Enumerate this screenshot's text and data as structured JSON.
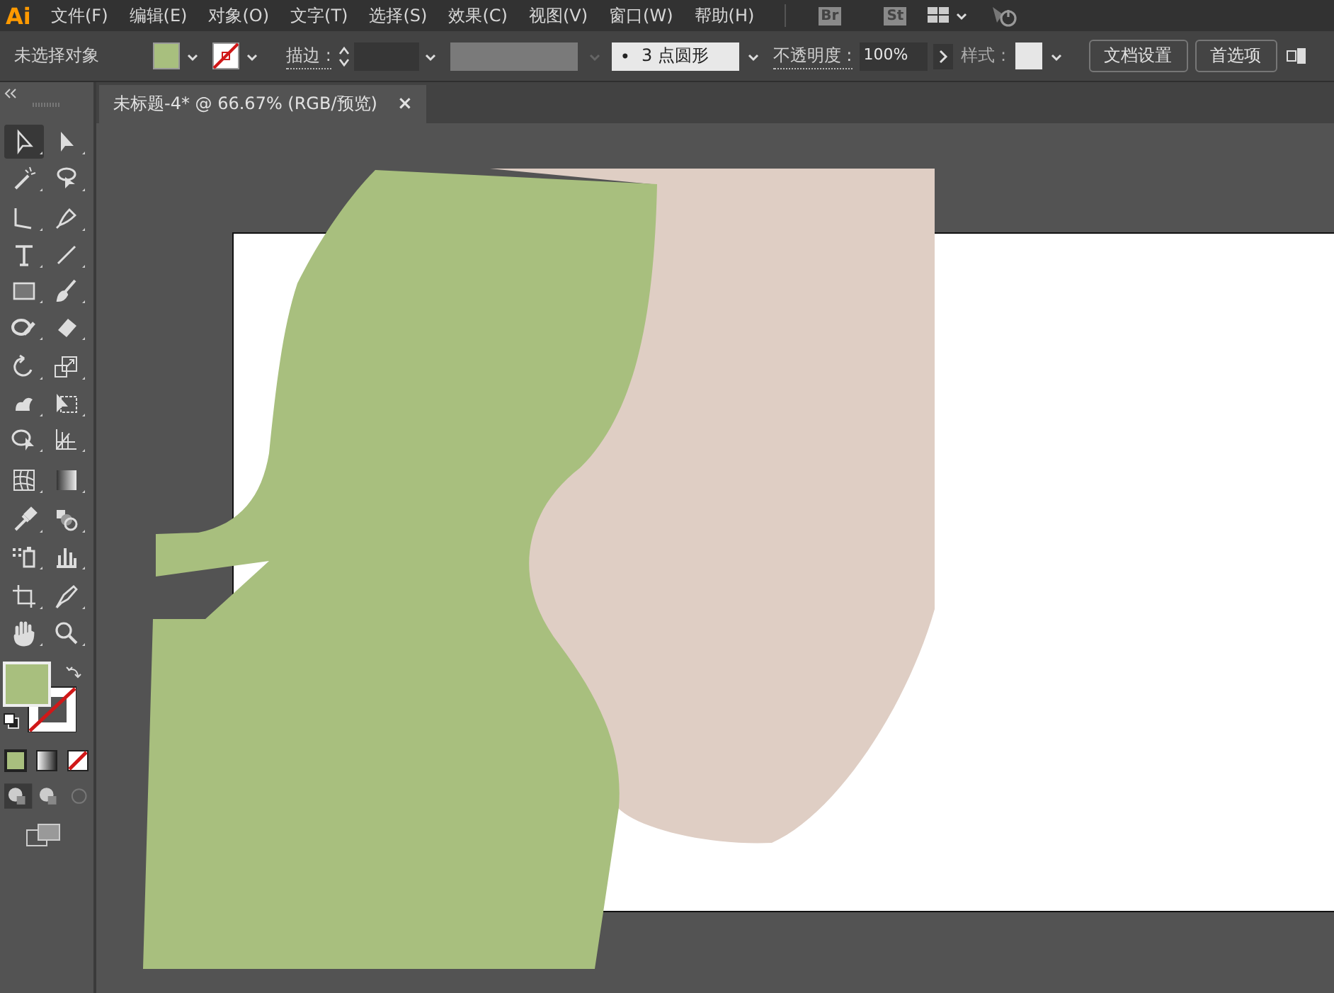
{
  "app": {
    "logo": "Ai"
  },
  "menu": [
    "文件(F)",
    "编辑(E)",
    "对象(O)",
    "文字(T)",
    "选择(S)",
    "效果(C)",
    "视图(V)",
    "窗口(W)",
    "帮助(H)"
  ],
  "app_badges": [
    "Br",
    "St"
  ],
  "control_bar": {
    "selection": "未选择对象",
    "stroke_label": "描边 :",
    "brush": "3 点圆形",
    "brush_dot": "•",
    "opacity_label": "不透明度 :",
    "opacity": "100%",
    "style_label": "样式 :",
    "buttons": [
      "文档设置",
      "首选项"
    ]
  },
  "document_tab": {
    "title": "未标题-4* @ 66.67% (RGB/预览)",
    "close": "×"
  },
  "tools": [
    {
      "kind": "selection",
      "selected": true
    },
    {
      "kind": "direct",
      "selected": false
    },
    {
      "kind": "wand",
      "selected": false
    },
    {
      "kind": "lasso",
      "selected": false
    },
    {
      "kind": "curvature",
      "selected": false
    },
    {
      "kind": "pen",
      "selected": false
    },
    {
      "kind": "type",
      "selected": false
    },
    {
      "kind": "line",
      "selected": false
    },
    {
      "kind": "rect",
      "selected": false
    },
    {
      "kind": "brush",
      "selected": false
    },
    {
      "kind": "shaper",
      "selected": false
    },
    {
      "kind": "eraser",
      "selected": false
    },
    {
      "kind": "rotate",
      "selected": false
    },
    {
      "kind": "scale",
      "selected": false
    },
    {
      "kind": "puppet",
      "selected": false
    },
    {
      "kind": "transform",
      "selected": false
    },
    {
      "kind": "builder",
      "selected": false
    },
    {
      "kind": "perspective",
      "selected": false
    },
    {
      "kind": "mesh",
      "selected": false
    },
    {
      "kind": "gradient",
      "selected": false
    },
    {
      "kind": "eyedropper",
      "selected": false
    },
    {
      "kind": "blend",
      "selected": false
    },
    {
      "kind": "sprayer",
      "selected": false
    },
    {
      "kind": "graph",
      "selected": false
    },
    {
      "kind": "artboard",
      "selected": false
    },
    {
      "kind": "knife",
      "selected": false
    },
    {
      "kind": "hand",
      "selected": false
    },
    {
      "kind": "zoom",
      "selected": false
    }
  ],
  "artwork": [
    {
      "kind": "artboard",
      "color": "#ffffff"
    },
    {
      "kind": "beige-shape",
      "color": "#dfcec4"
    },
    {
      "kind": "green-shape",
      "color": "#a8bf7e"
    }
  ]
}
